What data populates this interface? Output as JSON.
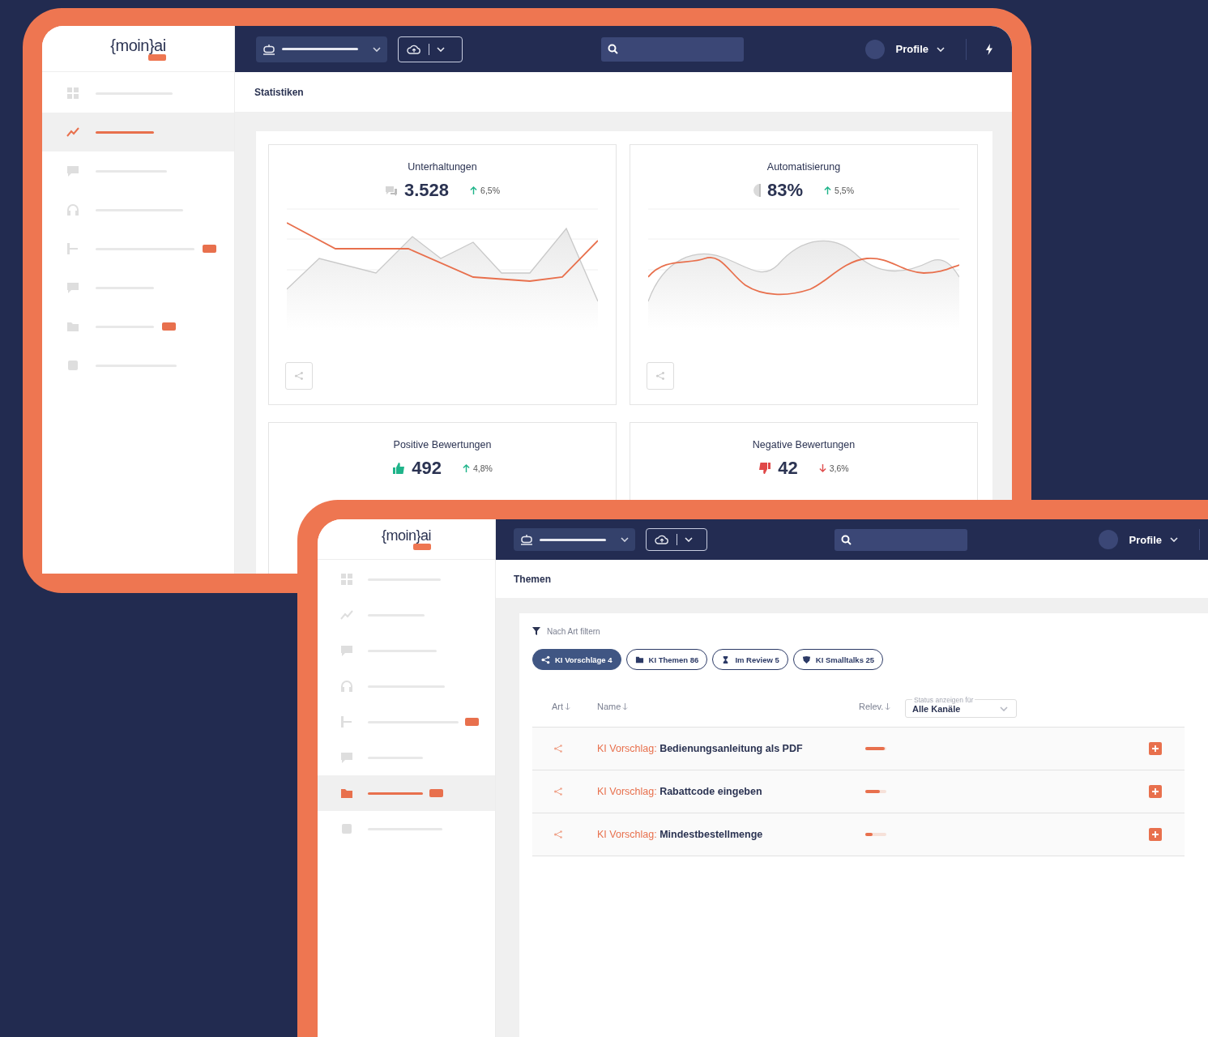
{
  "screens": [
    {
      "kind": "stats",
      "logo": "{moin}ai",
      "profile": "Profile",
      "page_title": "Statistiken",
      "sidebar": [
        {
          "selected": false,
          "badge": false
        },
        {
          "selected": true,
          "badge": false
        },
        {
          "selected": false,
          "badge": false
        },
        {
          "selected": false,
          "badge": false
        },
        {
          "selected": false,
          "badge": true
        },
        {
          "selected": false,
          "badge": false
        },
        {
          "selected": false,
          "badge": true
        },
        {
          "selected": false,
          "badge": false
        }
      ],
      "cards": [
        {
          "title": "Unterhaltungen",
          "value": "3.528",
          "rising": true,
          "change": "6,5%"
        },
        {
          "title": "Automatisierung",
          "value": "83%",
          "rising": true,
          "change": "5,5%"
        },
        {
          "title": "Positive Bewertungen",
          "value": "492",
          "rising": true,
          "change": "4,8%"
        },
        {
          "title": "Negative Bewertungen",
          "value": "42",
          "rising": false,
          "change": "3,6%"
        }
      ]
    },
    {
      "kind": "topics",
      "logo": "{moin}ai",
      "profile": "Profile",
      "page_title": "Themen",
      "sidebar": [
        {
          "selected": false,
          "badge": false
        },
        {
          "selected": false,
          "badge": false
        },
        {
          "selected": false,
          "badge": false
        },
        {
          "selected": false,
          "badge": false
        },
        {
          "selected": false,
          "badge": true
        },
        {
          "selected": false,
          "badge": false
        },
        {
          "selected": true,
          "badge": true
        },
        {
          "selected": false,
          "badge": false
        }
      ],
      "filter_label": "Nach Art filtern",
      "chips": [
        {
          "label": "KI Vorschläge",
          "count": "4",
          "selected": true
        },
        {
          "label": "KI Themen",
          "count": "86",
          "selected": false
        },
        {
          "label": "Im Review",
          "count": "5",
          "selected": false
        },
        {
          "label": "KI Smalltalks",
          "count": "25",
          "selected": false
        }
      ],
      "columns": [
        "Art",
        "Name",
        "Relev."
      ],
      "status_select": {
        "label": "Status anzeigen für",
        "value": "Alle Kanäle"
      },
      "rows": [
        {
          "prefix": "KI Vorschlag:",
          "name": "Bedienungsanleitung als PDF",
          "level": 0.92
        },
        {
          "prefix": "KI Vorschlag:",
          "name": "Rabattcode eingeben",
          "level": 0.7
        },
        {
          "prefix": "KI Vorschlag:",
          "name": "Mindestbestellmenge",
          "level": 0.35
        }
      ]
    }
  ]
}
